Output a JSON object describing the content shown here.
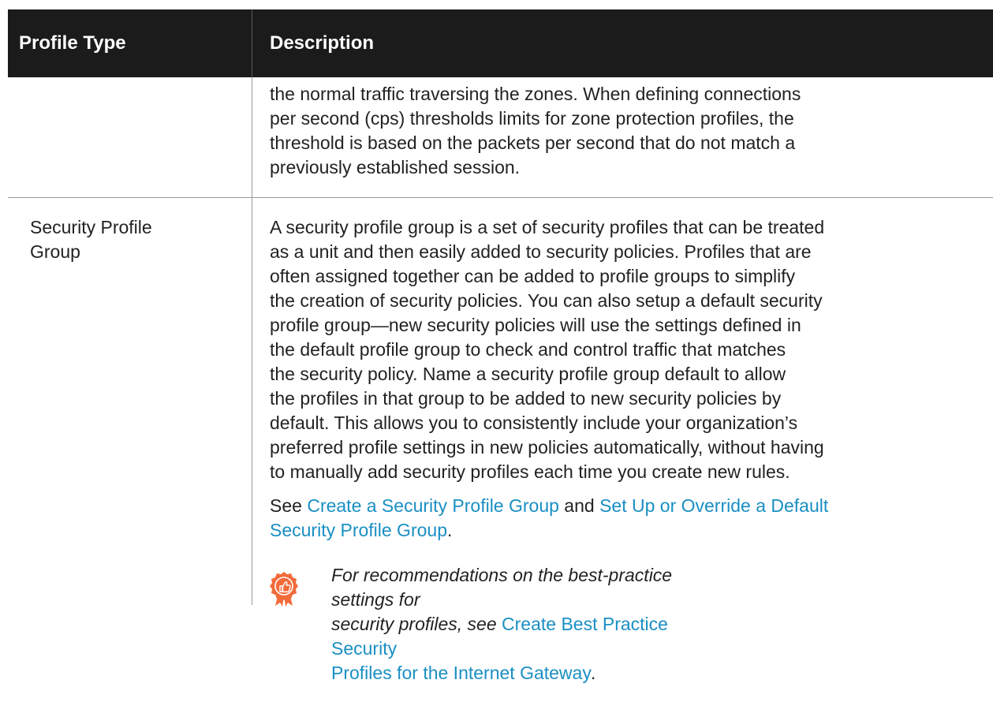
{
  "header": {
    "col_type": "Profile Type",
    "col_desc": "Description"
  },
  "rows": [
    {
      "type": "",
      "lines": [
        "the normal traffic traversing the zones. When defining connections",
        "per second (cps) thresholds limits for zone protection profiles, the",
        "threshold is based on the packets per second that do not match a",
        "previously established session."
      ]
    },
    {
      "type_lines": [
        "Security Profile",
        "Group"
      ],
      "lines": [
        "A security profile group is a set of security profiles that can be treated",
        "as a unit and then easily added to security policies. Profiles that are",
        "often assigned together can be added to profile groups to simplify",
        "the creation of security policies. You can also setup a default security",
        "profile group—new security policies will use the settings defined in",
        "the default profile group to check and control traffic that matches",
        "the security policy. Name a security profile group default to allow",
        "the profiles in that group to be added to new security policies by",
        "default. This allows you to consistently include your organization’s",
        "preferred profile settings in new policies automatically, without having",
        "to manually add security profiles each time you create new rules."
      ],
      "see": {
        "prefix": "See ",
        "link1": "Create a Security Profile Group",
        "mid": " and ",
        "link2_line1": "Set Up or Override a Default",
        "link2_line2": "Security Profile Group",
        "suffix": "."
      },
      "note": {
        "icon": "best-practice-badge-icon",
        "line1": "For recommendations on the best-practice settings for",
        "line2_text": "security profiles, see ",
        "link_line1": "Create Best Practice Security",
        "link_line2": "Profiles for the Internet Gateway",
        "suffix": "."
      }
    }
  ],
  "colors": {
    "header_bg": "#1b1b1b",
    "link": "#1a8fc3",
    "badge": "#f26b3a"
  }
}
